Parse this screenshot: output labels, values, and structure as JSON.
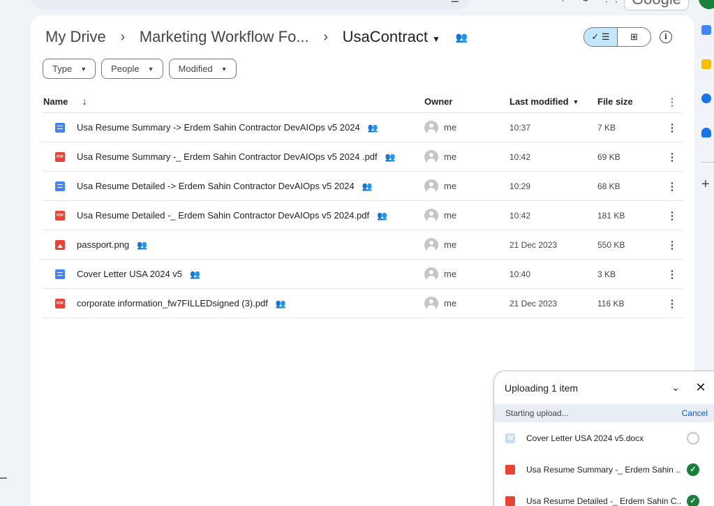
{
  "header": {
    "search_option_icon": "tune-icon",
    "account_label": "Google"
  },
  "breadcrumb": {
    "root": "My Drive",
    "parent": "Marketing Workflow Fo...",
    "current": "UsaContract"
  },
  "filters": {
    "type": "Type",
    "people": "People",
    "modified": "Modified"
  },
  "table": {
    "headers": {
      "name": "Name",
      "owner": "Owner",
      "last_modified": "Last modified",
      "file_size": "File size"
    },
    "rows": [
      {
        "type": "doc",
        "name": "Usa Resume Summary -> Erdem Sahin Contractor DevAIOps v5 2024",
        "owner": "me",
        "modified": "10:37",
        "size": "7 KB"
      },
      {
        "type": "pdf",
        "name": "Usa Resume Summary -_ Erdem Sahin Contractor DevAIOps v5 2024 .pdf",
        "owner": "me",
        "modified": "10:42",
        "size": "69 KB"
      },
      {
        "type": "doc",
        "name": "Usa Resume Detailed -> Erdem Sahin Contractor DevAIOps v5 2024",
        "owner": "me",
        "modified": "10:29",
        "size": "68 KB"
      },
      {
        "type": "pdf",
        "name": "Usa Resume Detailed -_ Erdem Sahin Contractor DevAIOps v5 2024.pdf",
        "owner": "me",
        "modified": "10:42",
        "size": "181 KB"
      },
      {
        "type": "img",
        "name": "passport.png",
        "owner": "me",
        "modified": "21 Dec 2023",
        "size": "550 KB"
      },
      {
        "type": "doc",
        "name": "Cover Letter USA 2024 v5",
        "owner": "me",
        "modified": "10:40",
        "size": "3 KB"
      },
      {
        "type": "pdf",
        "name": "corporate information_fw7FILLEDsigned (3).pdf",
        "owner": "me",
        "modified": "21 Dec 2023",
        "size": "116 KB"
      }
    ]
  },
  "upload": {
    "title": "Uploading 1 item",
    "status": "Starting upload...",
    "cancel": "Cancel",
    "items": [
      {
        "type": "word",
        "name": "Cover Letter USA 2024 v5.docx",
        "state": "pending"
      },
      {
        "type": "pdf",
        "name": "Usa Resume Summary -_ Erdem Sahin ...",
        "state": "done"
      },
      {
        "type": "pdf",
        "name": "Usa Resume Detailed -_ Erdem Sahin C...",
        "state": "done"
      }
    ]
  },
  "colors": {
    "accent": "#0b57d0",
    "selected_view": "#c2e7ff",
    "doc_blue": "#4285f4",
    "pdf_red": "#ea4335",
    "success_green": "#188038"
  }
}
